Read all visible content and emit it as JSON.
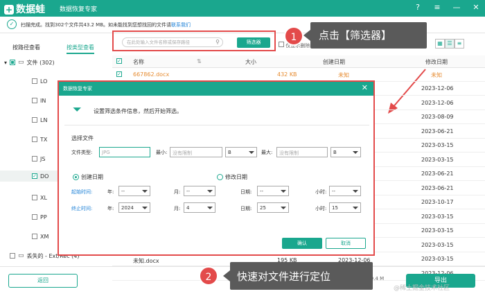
{
  "app": {
    "logo": "数据蛙",
    "title": "数据恢复专家"
  },
  "window_buttons": {
    "help": "?",
    "menu": "≡",
    "minimize": "—",
    "close": "✕"
  },
  "status": {
    "text": "扫描完成。找到302个文件共43.2 MB。如未能找到您想找回的文件请",
    "link": "联系我们"
  },
  "tabs": [
    "按路径查看",
    "按类型查看"
  ],
  "search": {
    "placeholder": "在此处输入文件名称或保存路径",
    "filter_button": "筛选器"
  },
  "show_deleted": "仅显示删除的",
  "callouts": {
    "one": {
      "number": "1",
      "text": "点击【筛选器】"
    },
    "two": {
      "number": "2",
      "text": "快速对文件进行定位"
    }
  },
  "tree": {
    "root": "文件 (302)",
    "items": [
      "LO",
      "IN",
      "LN",
      "TX",
      "JS",
      "DO",
      "XL",
      "PP",
      "XM"
    ],
    "lost": "丢失的 - Ext/Rec (4)"
  },
  "table": {
    "headers": [
      "名称",
      "大小",
      "创建日期",
      "修改日期"
    ],
    "first_row": {
      "name": "667862.docx",
      "size": "432 KB",
      "created": "未知",
      "modified": "未知"
    },
    "modified_dates": [
      "2023-12-06",
      "2023-12-06",
      "2023-08-09",
      "2023-06-21",
      "2023-03-15",
      "2023-03-15",
      "2023-06-21",
      "2023-06-21",
      "2023-10-17",
      "2023-03-15",
      "2023-03-15",
      "2023-03-15",
      "2023-03-15",
      "2023-12-06"
    ],
    "partial_row": {
      "name": "未知.docx",
      "size": "195 KB",
      "created": "2023-12-06"
    }
  },
  "dialog": {
    "title": "数据恢复专家",
    "info": "设置筛选条件信息，然后开始筛选。",
    "section_file": "选择文件",
    "file_type_label": "文件类型:",
    "file_type_placeholder": "JPG",
    "min_label": "最小:",
    "min_placeholder": "没有限制",
    "min_unit": "B",
    "max_label": "最大:",
    "max_placeholder": "没有限制",
    "max_unit": "B",
    "radio_created": "创建日期",
    "radio_modified": "修改日期",
    "start_label": "起始时间:",
    "end_label": "终止时间:",
    "year_label": "年:",
    "month_label": "月:",
    "day_label": "日期:",
    "hour_label": "小时:",
    "start": {
      "year": "--",
      "month": "--",
      "day": "--",
      "hour": "--"
    },
    "end": {
      "year": "2024",
      "month": "4",
      "day": "25",
      "hour": "15"
    },
    "ok": "确认",
    "cancel": "取消"
  },
  "bottom": {
    "back": "返回",
    "export": "导出",
    "size": "/29.4 M"
  },
  "watermark": "@稀土掘金技术社区"
}
